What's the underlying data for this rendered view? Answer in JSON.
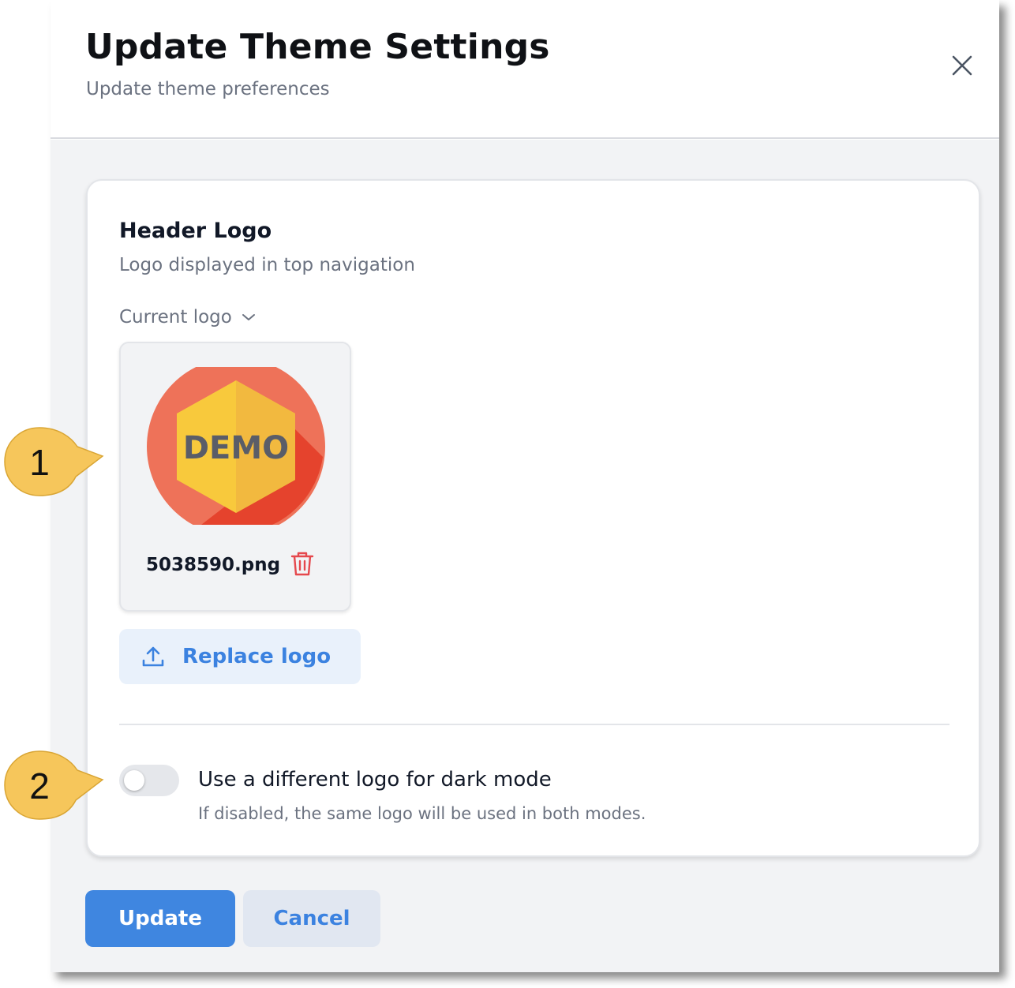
{
  "dialog": {
    "title": "Update Theme Settings",
    "subtitle": "Update theme preferences"
  },
  "header_logo": {
    "title": "Header Logo",
    "description": "Logo displayed in top navigation",
    "current_logo_label": "Current logo",
    "logo_image_text": "DEMO",
    "file_name": "5038590.png",
    "replace_label": "Replace logo"
  },
  "dark_mode": {
    "label": "Use a different logo for dark mode",
    "help": "If disabled, the same logo will be used in both modes.",
    "enabled": false
  },
  "actions": {
    "update_label": "Update",
    "cancel_label": "Cancel"
  },
  "callouts": [
    "1",
    "2"
  ],
  "colors": {
    "primary": "#3f86e0",
    "danger": "#e5484d",
    "callout": "#f6c65b"
  },
  "icons": [
    "close-icon",
    "chevron-down-icon",
    "trash-icon",
    "upload-icon"
  ]
}
